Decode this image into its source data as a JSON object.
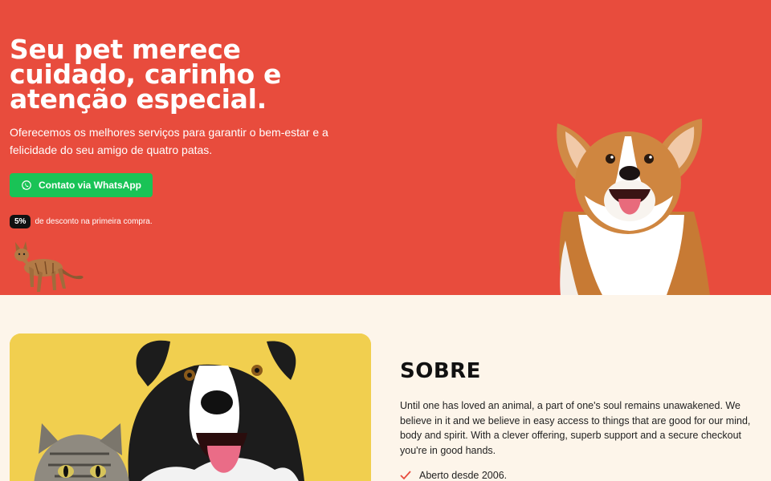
{
  "hero": {
    "title": "Seu pet merece cuidado, carinho e atenção especial.",
    "subtitle": "Oferecemos os melhores serviços para garantir o bem-estar e a felicidade do seu amigo de quatro patas.",
    "whatsapp_button": "Contato via WhatsApp",
    "discount_badge": "5%",
    "discount_text": "de desconto na primeira compra."
  },
  "about": {
    "title": "SOBRE",
    "text": "Until one has loved an animal, a part of one's soul remains unawakened. We believe in it and we believe in easy access to things that are good for our mind, body and spirit. With a clever offering, superb support and a secure checkout you're in good hands.",
    "features": [
      {
        "label": "Aberto desde 2006."
      }
    ]
  },
  "colors": {
    "hero_bg": "#e84c3d",
    "page_bg": "#fdf5ea",
    "whatsapp_green": "#19c356",
    "check_red": "#e84c3d"
  },
  "icons": {
    "whatsapp": "whatsapp-icon",
    "check": "check-icon"
  }
}
